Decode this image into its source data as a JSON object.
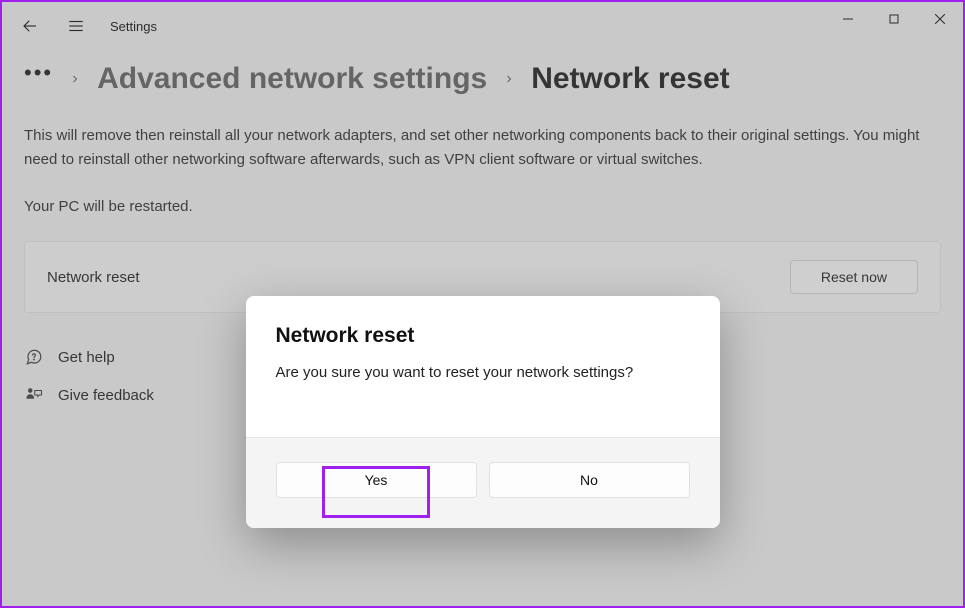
{
  "header": {
    "app_title": "Settings"
  },
  "breadcrumb": {
    "parent": "Advanced network settings",
    "current": "Network reset"
  },
  "main": {
    "description": "This will remove then reinstall all your network adapters, and set other networking components back to their original settings. You might need to reinstall other networking software afterwards, such as VPN client software or virtual switches.",
    "restart_note": "Your PC will be restarted.",
    "reset_card_title": "Network reset",
    "reset_now_label": "Reset now"
  },
  "footer": {
    "help_label": "Get help",
    "feedback_label": "Give feedback"
  },
  "dialog": {
    "title": "Network reset",
    "message": "Are you sure you want to reset your network settings?",
    "yes_label": "Yes",
    "no_label": "No"
  }
}
